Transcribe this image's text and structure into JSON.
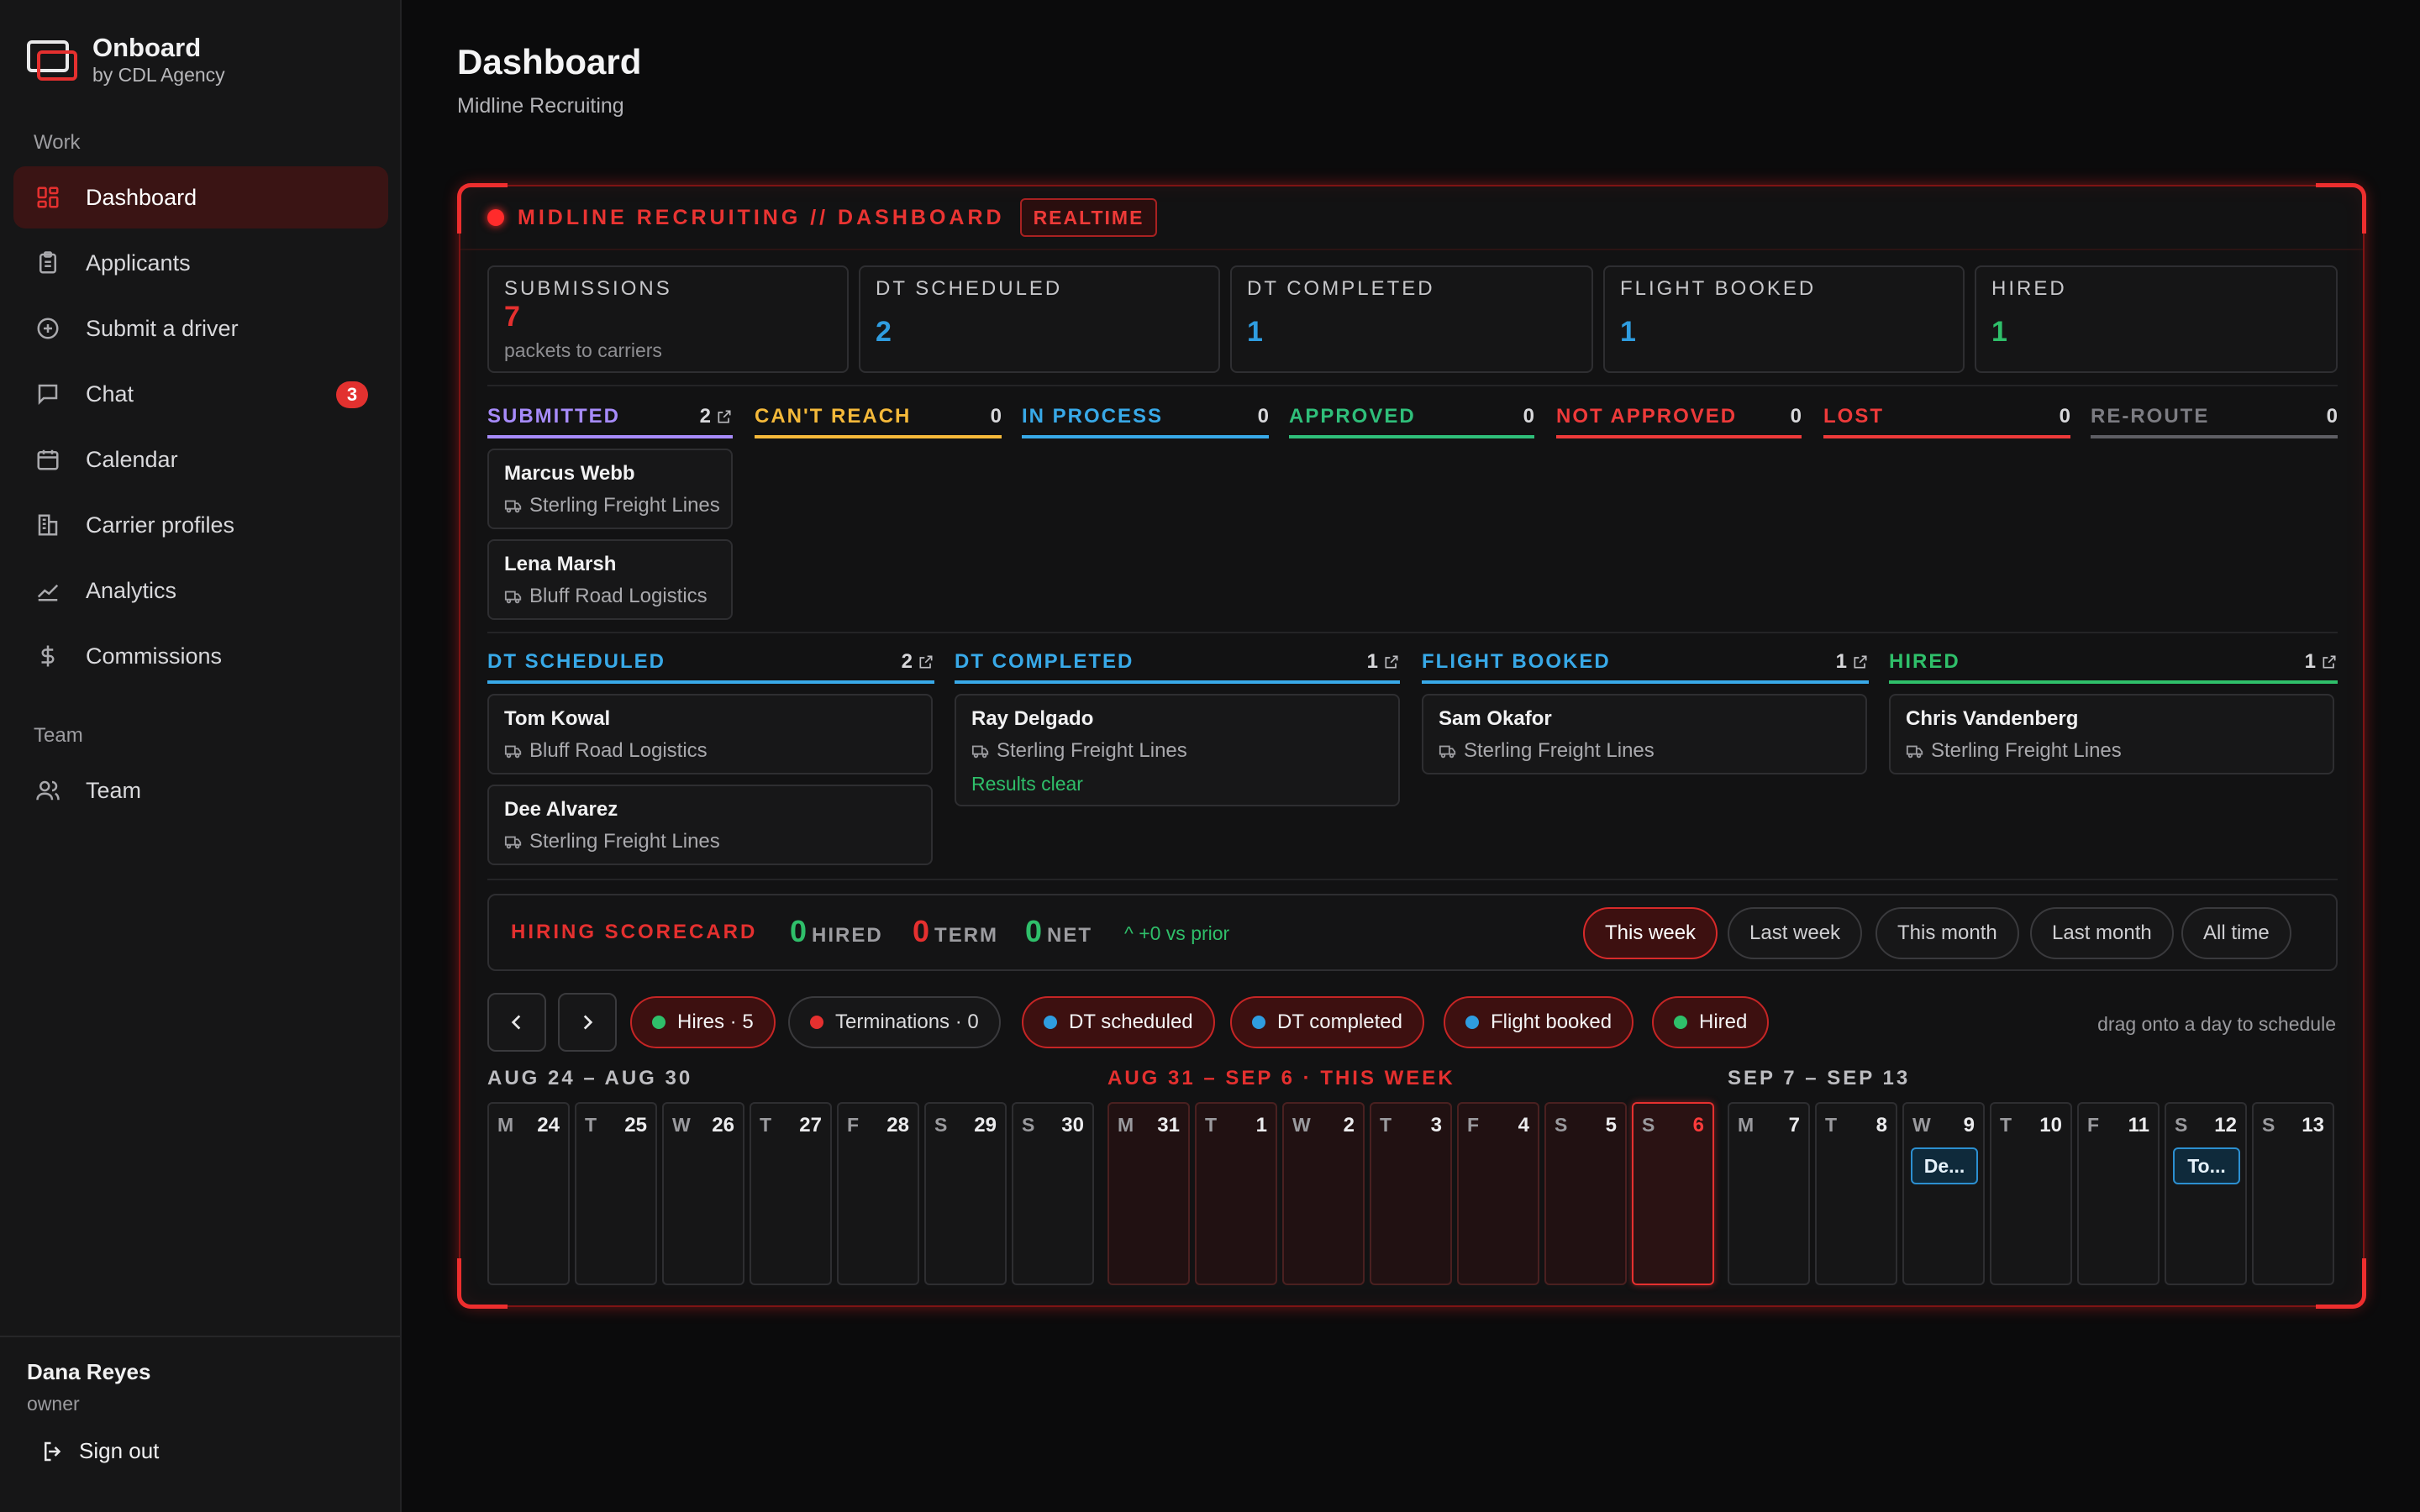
{
  "brand": {
    "title": "Onboard",
    "subtitle": "by CDL Agency"
  },
  "sidebar": {
    "section_work": "Work",
    "section_team": "Team",
    "items": [
      {
        "label": "Dashboard",
        "icon": "dashboard-grid-icon",
        "active": true
      },
      {
        "label": "Applicants",
        "icon": "clipboard-icon"
      },
      {
        "label": "Submit a driver",
        "icon": "plus-circle-icon"
      },
      {
        "label": "Chat",
        "icon": "chat-bubble-icon",
        "badge": "3"
      },
      {
        "label": "Calendar",
        "icon": "calendar-icon"
      },
      {
        "label": "Carrier profiles",
        "icon": "building-icon"
      },
      {
        "label": "Analytics",
        "icon": "trend-line-icon"
      },
      {
        "label": "Commissions",
        "icon": "dollar-icon"
      },
      {
        "label": "Team",
        "icon": "users-icon"
      }
    ],
    "user": {
      "name": "Dana Reyes",
      "role": "owner"
    },
    "signout": "Sign out"
  },
  "header": {
    "title": "Dashboard",
    "subtitle": "Midline Recruiting"
  },
  "panel": {
    "heading": "MIDLINE RECRUITING // DASHBOARD",
    "badge": "REALTIME",
    "stats": [
      {
        "label": "SUBMISSIONS",
        "value": "7",
        "sub": "packets to carriers",
        "color": "#e5302f"
      },
      {
        "label": "DT SCHEDULED",
        "value": "2",
        "color": "#2f9de0"
      },
      {
        "label": "DT COMPLETED",
        "value": "1",
        "color": "#2f9de0"
      },
      {
        "label": "FLIGHT BOOKED",
        "value": "1",
        "color": "#2f9de0"
      },
      {
        "label": "HIRED",
        "value": "1",
        "color": "#2fbf6a"
      }
    ],
    "stage_row1": [
      {
        "name": "SUBMITTED",
        "count": "2",
        "color": "#a78bfa",
        "link": true,
        "cards": [
          {
            "name": "Marcus Webb",
            "carrier": "Sterling Freight Lines"
          },
          {
            "name": "Lena Marsh",
            "carrier": "Bluff Road Logistics"
          }
        ]
      },
      {
        "name": "CAN'T REACH",
        "count": "0",
        "color": "#f5b93a"
      },
      {
        "name": "IN PROCESS",
        "count": "0",
        "color": "#38a9e8"
      },
      {
        "name": "APPROVED",
        "count": "0",
        "color": "#2fbf7a"
      },
      {
        "name": "NOT APPROVED",
        "count": "0",
        "color": "#ee3a3a"
      },
      {
        "name": "LOST",
        "count": "0",
        "color": "#ee3a3a"
      },
      {
        "name": "RE-ROUTE",
        "count": "0",
        "color": "#7c7c82"
      }
    ],
    "stage_row2": [
      {
        "name": "DT SCHEDULED",
        "count": "2",
        "color": "#38a9e8",
        "cards": [
          {
            "name": "Tom Kowal",
            "carrier": "Bluff Road Logistics"
          },
          {
            "name": "Dee Alvarez",
            "carrier": "Sterling Freight Lines"
          }
        ]
      },
      {
        "name": "DT COMPLETED",
        "count": "1",
        "color": "#38a9e8",
        "cards": [
          {
            "name": "Ray Delgado",
            "carrier": "Sterling Freight Lines",
            "note": "Results clear"
          }
        ]
      },
      {
        "name": "FLIGHT BOOKED",
        "count": "1",
        "color": "#38a9e8",
        "cards": [
          {
            "name": "Sam Okafor",
            "carrier": "Sterling Freight Lines"
          }
        ]
      },
      {
        "name": "HIRED",
        "count": "1",
        "color": "#2fbf6a",
        "cards": [
          {
            "name": "Chris Vandenberg",
            "carrier": "Sterling Freight Lines"
          }
        ]
      }
    ],
    "scorecard": {
      "title": "HIRING SCORECARD",
      "hired_num": "0",
      "hired_label": "HIRED",
      "term_num": "0",
      "term_label": "TERM",
      "net_num": "0",
      "net_label": "NET",
      "trend": "+0 vs prior",
      "ranges": [
        {
          "label": "This week",
          "active": true
        },
        {
          "label": "Last week"
        },
        {
          "label": "This month"
        },
        {
          "label": "Last month"
        },
        {
          "label": "All time"
        }
      ]
    },
    "filters": [
      {
        "label": "Hires · 5",
        "dot": "#2fbf6a",
        "on": true
      },
      {
        "label": "Terminations · 0",
        "dot": "#e5302f",
        "on": false
      },
      {
        "label": "DT scheduled",
        "dot": "#2f9de0",
        "on": true
      },
      {
        "label": "DT completed",
        "dot": "#2f9de0",
        "on": true
      },
      {
        "label": "Flight booked",
        "dot": "#2f9de0",
        "on": true
      },
      {
        "label": "Hired",
        "dot": "#2fbf6a",
        "on": true
      }
    ],
    "drag_hint": "drag onto a day to schedule",
    "weeks": [
      {
        "label": "AUG 24 – AUG 30",
        "color": "#bdbdc1",
        "current": false,
        "days": [
          [
            "M",
            "24"
          ],
          [
            "T",
            "25"
          ],
          [
            "W",
            "26"
          ],
          [
            "T",
            "27"
          ],
          [
            "F",
            "28"
          ],
          [
            "S",
            "29"
          ],
          [
            "S",
            "30"
          ]
        ]
      },
      {
        "label": "AUG 31 – SEP 6 · THIS WEEK",
        "color": "#e5302f",
        "current": true,
        "days": [
          [
            "M",
            "31"
          ],
          [
            "T",
            "1"
          ],
          [
            "W",
            "2"
          ],
          [
            "T",
            "3"
          ],
          [
            "F",
            "4"
          ],
          [
            "S",
            "5"
          ],
          [
            "S",
            "6"
          ]
        ]
      },
      {
        "label": "SEP 7 – SEP 13",
        "color": "#bdbdc1",
        "current": false,
        "days": [
          [
            "M",
            "7"
          ],
          [
            "T",
            "8"
          ],
          [
            "W",
            "9"
          ],
          [
            "T",
            "10"
          ],
          [
            "F",
            "11"
          ],
          [
            "S",
            "12"
          ],
          [
            "S",
            "13"
          ]
        ]
      }
    ],
    "events": [
      {
        "week": 2,
        "day": 2,
        "label": "De..."
      },
      {
        "week": 2,
        "day": 5,
        "label": "To..."
      }
    ]
  }
}
